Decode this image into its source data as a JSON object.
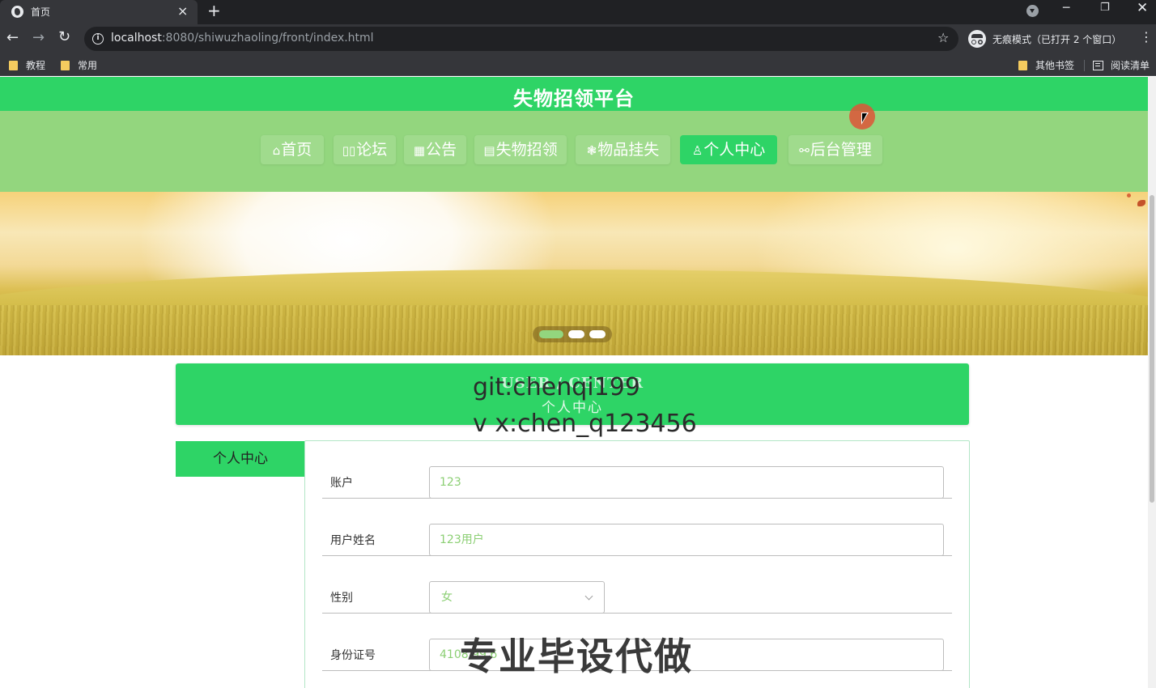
{
  "browser": {
    "tab_title": "首页",
    "tab_close": "×",
    "new_tab": "+",
    "url_host": "localhost",
    "url_path": ":8080/shiwuzhaoling/front/index.html",
    "incognito_label": "无痕模式（已打开 2 个窗口）",
    "bookmarks": [
      "教程",
      "常用"
    ],
    "other_bookmarks": "其他书签",
    "reading_list": "阅读清单",
    "icons": [
      "back-icon",
      "forward-icon",
      "reload-icon",
      "info-icon",
      "star-icon",
      "incognito-icon",
      "menu-icon",
      "folder-icon",
      "reading-list-icon"
    ]
  },
  "site": {
    "title": "失物招领平台",
    "nav": [
      {
        "icon": "⌂",
        "label": "首页"
      },
      {
        "icon": "▯▯",
        "label": "论坛"
      },
      {
        "icon": "▦",
        "label": "公告"
      },
      {
        "icon": "▤",
        "label": "失物招领"
      },
      {
        "icon": "❃",
        "label": "物品挂失"
      },
      {
        "icon": "♙",
        "label": "个人中心",
        "active": true
      },
      {
        "icon": "⚯",
        "label": "后台管理"
      }
    ],
    "carousel_active_index": 0,
    "carousel_count": 3
  },
  "section": {
    "title_en": "USER / CENTER",
    "title_cn": "个人中心"
  },
  "sidebar": {
    "active_item": "个人中心"
  },
  "form": {
    "account_label": "账户",
    "account_value": "123",
    "name_label": "用户姓名",
    "name_value": "123用户",
    "gender_label": "性别",
    "gender_value": "女",
    "id_label": "身份证号",
    "id_value": "4108        99        6"
  },
  "watermarks": {
    "git": "git:chenqi199",
    "vx": "v x:chen_q123456",
    "ad": "专业毕设代做"
  },
  "colors": {
    "header_green": "#2ed466",
    "nav_green": "#93d67e",
    "input_text": "#8ccf74"
  }
}
